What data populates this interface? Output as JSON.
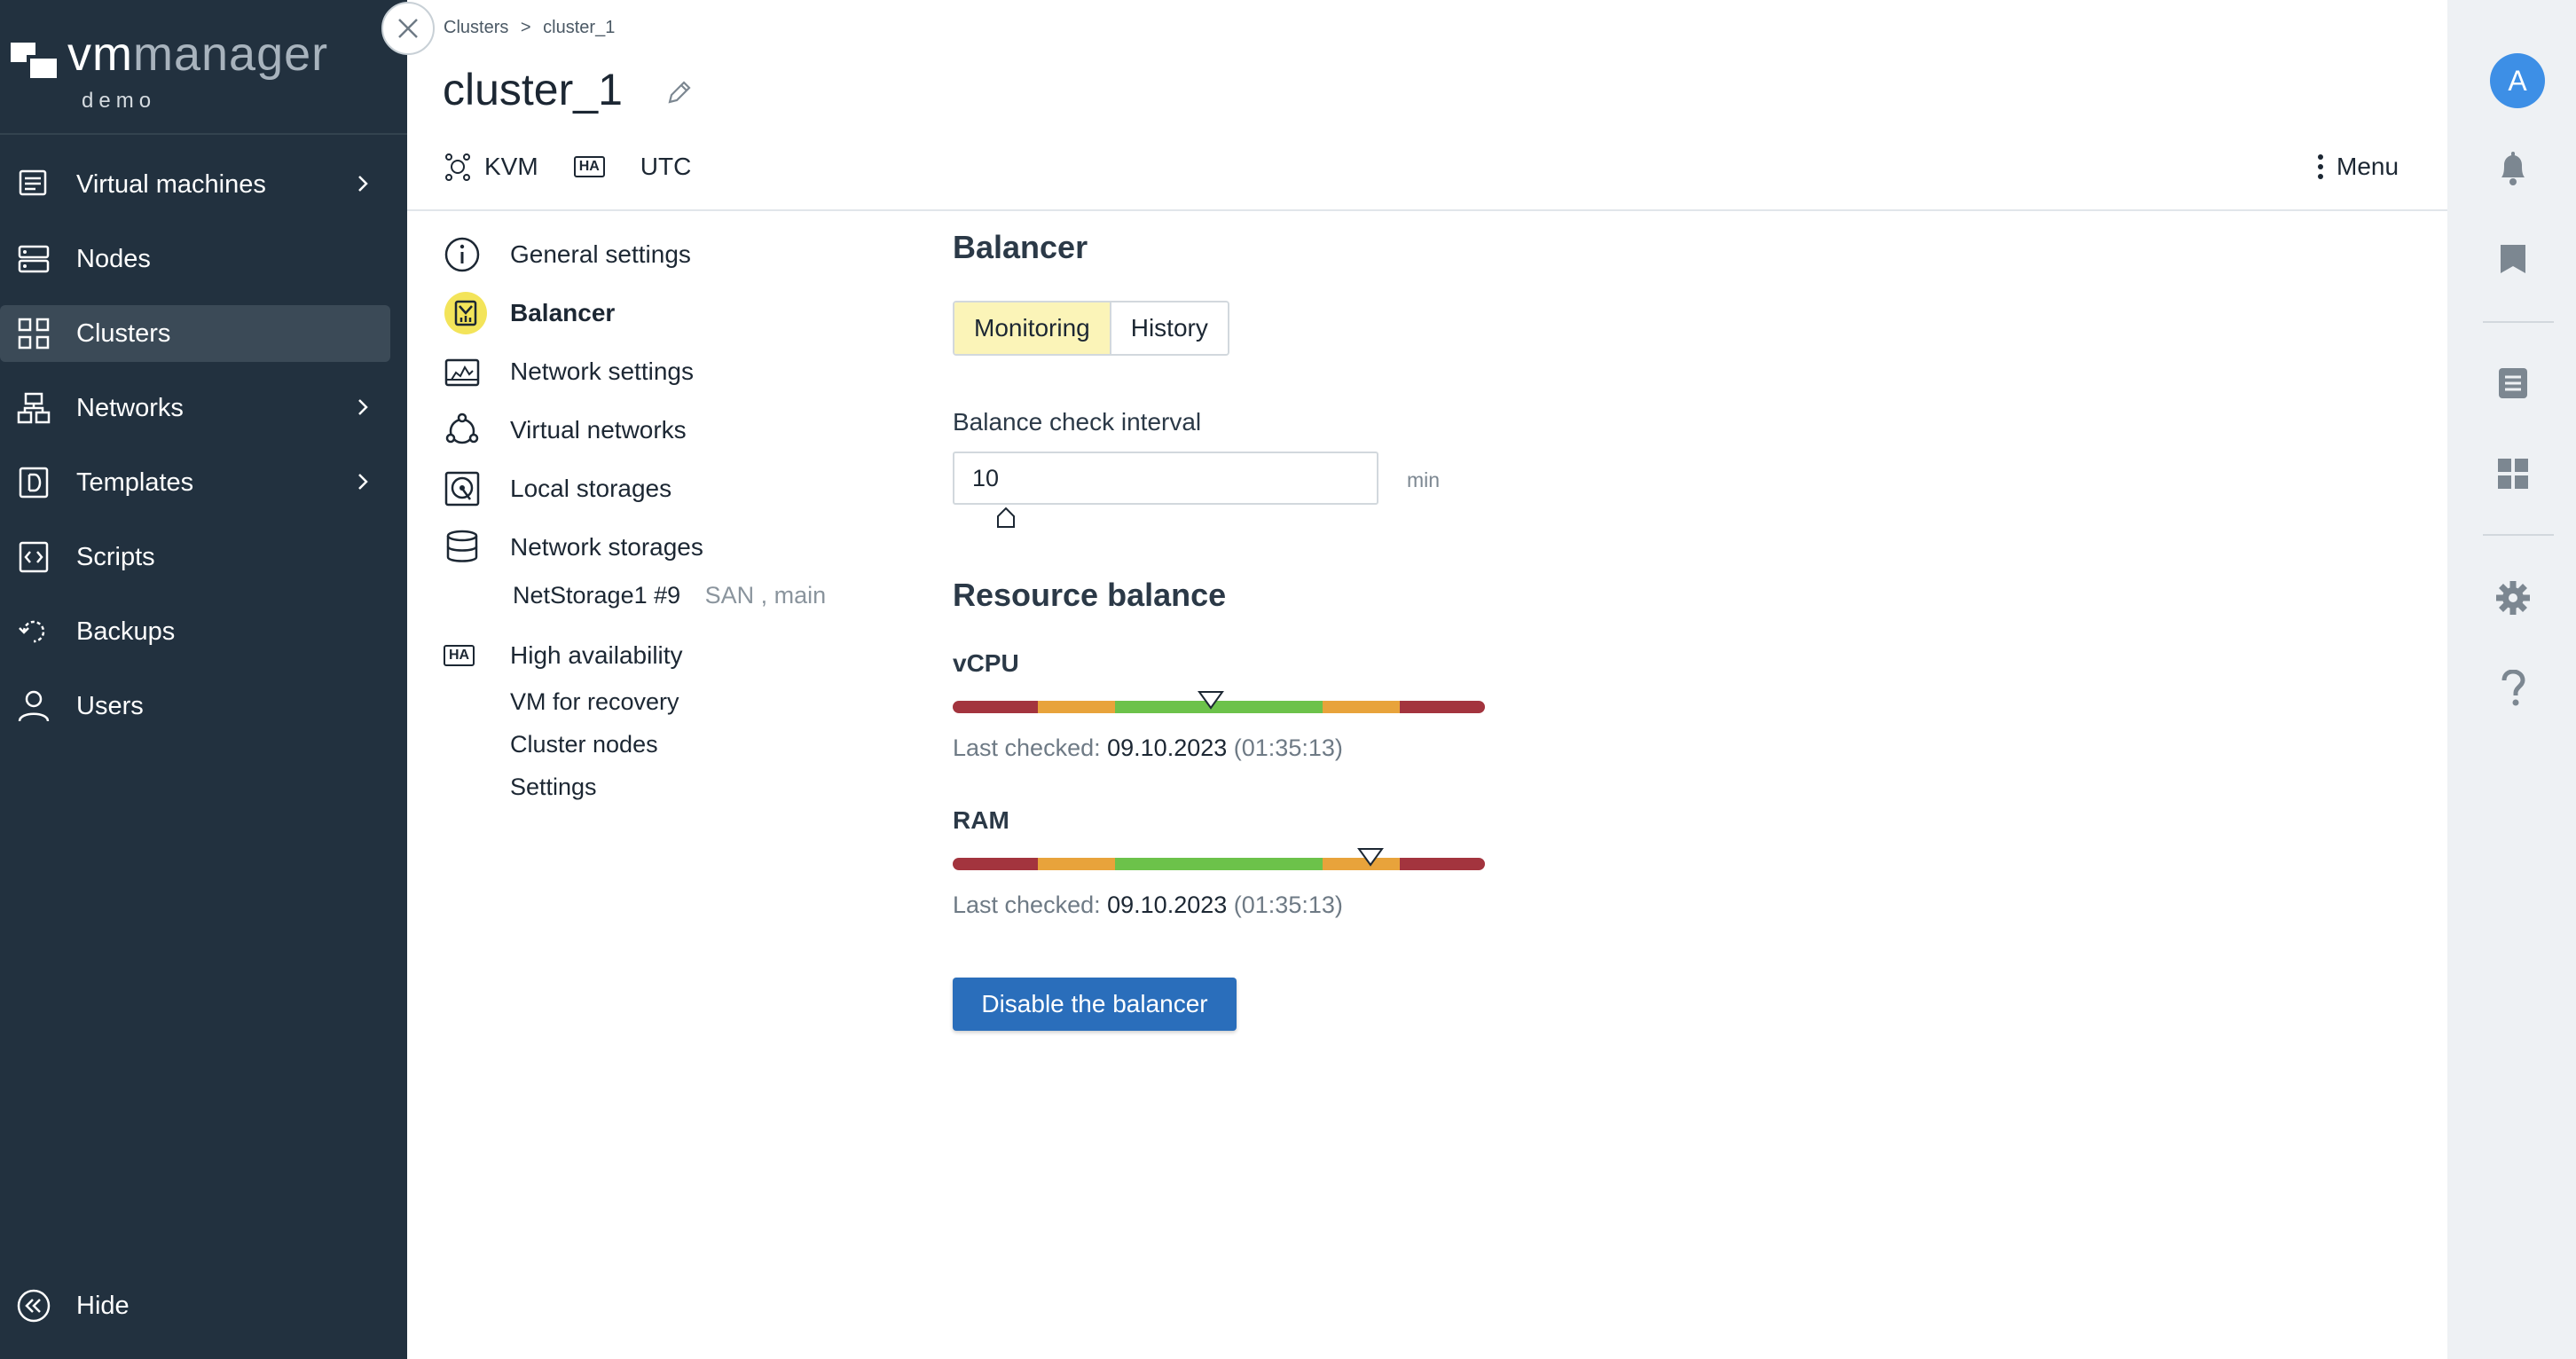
{
  "app": {
    "brand_vm": "vm",
    "brand_manager": "manager",
    "brand_sub": "demo"
  },
  "sidebar": {
    "items": [
      {
        "label": "Virtual machines",
        "icon": "virtual-machines-icon",
        "has_chevron": true
      },
      {
        "label": "Nodes",
        "icon": "nodes-icon",
        "has_chevron": false
      },
      {
        "label": "Clusters",
        "icon": "clusters-icon",
        "has_chevron": false,
        "active": true
      },
      {
        "label": "Networks",
        "icon": "networks-icon",
        "has_chevron": true
      },
      {
        "label": "Templates",
        "icon": "templates-icon",
        "has_chevron": true
      },
      {
        "label": "Scripts",
        "icon": "scripts-icon",
        "has_chevron": false
      },
      {
        "label": "Backups",
        "icon": "backups-icon",
        "has_chevron": false
      },
      {
        "label": "Users",
        "icon": "users-icon",
        "has_chevron": false
      }
    ],
    "hide_label": "Hide"
  },
  "header": {
    "breadcrumb_root": "Clusters",
    "breadcrumb_sep": ">",
    "breadcrumb_current": "cluster_1",
    "title": "cluster_1",
    "meta": {
      "virt": "KVM",
      "ha": "HA",
      "tz": "UTC"
    },
    "menu_label": "Menu"
  },
  "subnav": {
    "general": "General settings",
    "balancer": "Balancer",
    "network_settings": "Network settings",
    "virtual_networks": "Virtual networks",
    "local_storages": "Local storages",
    "network_storages": "Network storages",
    "storage_name": "NetStorage1 #9",
    "storage_tags": "SAN , main",
    "high_availability": "High availability",
    "ha_icon_text": "HA",
    "vm_recovery": "VM for recovery",
    "cluster_nodes": "Cluster nodes",
    "settings": "Settings"
  },
  "balancer": {
    "title": "Balancer",
    "tabs": {
      "monitoring": "Monitoring",
      "history": "History",
      "active": "monitoring"
    },
    "interval_label": "Balance check interval",
    "interval_value": "10",
    "interval_unit": "min",
    "resource_title": "Resource balance",
    "vcpu": {
      "label": "vCPU",
      "marker_fraction": 0.485,
      "checked_prefix": "Last checked:",
      "date": "09.10.2023",
      "time": "(01:35:13)"
    },
    "ram": {
      "label": "RAM",
      "marker_fraction": 0.785,
      "checked_prefix": "Last checked:",
      "date": "09.10.2023",
      "time": "(01:35:13)"
    },
    "bar_colors": {
      "red": "#a3343e",
      "orange": "#e8a33b",
      "green": "#6cc24a"
    },
    "disable_button": "Disable the balancer"
  },
  "rail": {
    "avatar_letter": "A",
    "icons": [
      "bell-icon",
      "bookmark-icon",
      "list-icon",
      "dashboard-icon",
      "gear-icon",
      "help-icon"
    ]
  },
  "colors": {
    "sidebar_bg": "#22313f",
    "accent": "#2a6ebb",
    "active_tab": "#fbf4b8"
  }
}
